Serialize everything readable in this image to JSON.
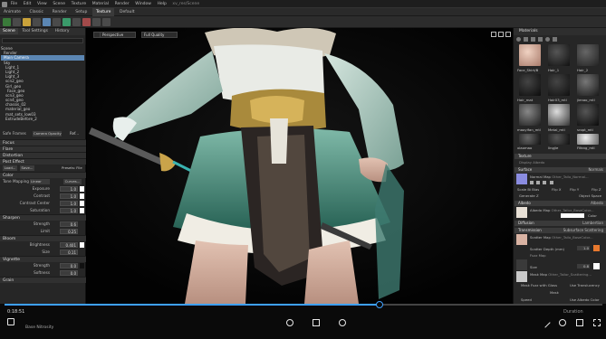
{
  "titlebar": {
    "items": [
      "File",
      "Edit",
      "View",
      "Scene",
      "Texture",
      "Material",
      "Render",
      "Window",
      "Help"
    ],
    "filename": "xv_res/Scene"
  },
  "tabbar": {
    "tabs": [
      "Animate",
      "Classic",
      "Render",
      "Setup",
      "Texture",
      "Default"
    ],
    "active": 4
  },
  "left_panel": {
    "tabs": [
      "Scene",
      "Tool Settings",
      "History"
    ],
    "active_tab": 0,
    "tree": [
      "Scene",
      "Render",
      "Main Camera",
      "Sky",
      "Light_1",
      "Light_2",
      "Light_3",
      "scn2_geo",
      "Girl_geo",
      "Face_geo",
      "scn3_geo",
      "scn4_geo",
      "chassis_02",
      "material_geo",
      "mat_sets_low03",
      "ExtrudeBefore_2"
    ],
    "selected_index": 2,
    "view_row": {
      "label": "Safe Frames",
      "value": "Camera Opacity",
      "button": "Ref..."
    },
    "sections": {
      "focus": "Focus",
      "flare": "Flare",
      "distortion": "Distortion",
      "post_effect": "Post Effect"
    },
    "post_buttons": [
      "Load...",
      "Save...",
      "Presets: File"
    ],
    "color_section": "Color",
    "tone_mapping": {
      "label": "Tone Mapping",
      "value": "Linear",
      "curves": "Curves..."
    },
    "color_rows": [
      {
        "label": "Exposure",
        "value": "1.0"
      },
      {
        "label": "Contrast",
        "value": "1.0"
      },
      {
        "label": "Contrast Center",
        "value": "1.0"
      },
      {
        "label": "Saturation",
        "value": "1.0"
      }
    ],
    "sharpen_section": "Sharpen",
    "sharpen_rows": [
      {
        "label": "Strength",
        "value": "0.6"
      },
      {
        "label": "Limit",
        "value": "0.25"
      }
    ],
    "bloom_section": "Bloom",
    "bloom_rows": [
      {
        "label": "Brightness",
        "value": "0.401"
      },
      {
        "label": "Size",
        "value": "0.11"
      }
    ],
    "vignette_section": "Vignette",
    "vignette_rows": [
      {
        "label": "Strength",
        "value": "0.0"
      },
      {
        "label": "Softness",
        "value": "0.0"
      }
    ],
    "grain_section": "Grain"
  },
  "viewport": {
    "camera": "Perspective",
    "quality": "Full Quality"
  },
  "right_panel": {
    "header": "Materials",
    "materials": [
      {
        "label": "Face_Shirt/B",
        "color": "#d8b7a7"
      },
      {
        "label": "Hair_1",
        "color": "#2a2a2a"
      },
      {
        "label": "Hair_2",
        "color": "#3a3a3a"
      },
      {
        "label": "Hair_mat",
        "color": "#1a1a1a"
      },
      {
        "label": "Hair03_mtl",
        "color": "#1d1d1d"
      },
      {
        "label": "jienao_mtl",
        "color": "#282828"
      },
      {
        "label": "maoyifan_mtl",
        "color": "#424242"
      },
      {
        "label": "Metal_mtl",
        "color": "#8a8a8a"
      },
      {
        "label": "sropt_mtl",
        "color": "#111111"
      },
      {
        "label": "xiaomao",
        "color": "#2e2e2e"
      },
      {
        "label": "lingjie",
        "color": "#141414"
      },
      {
        "label": "Fifang_mtl",
        "color": "#c0c0c0"
      }
    ],
    "texture_section": "Texture",
    "display_label": "Display Albedo",
    "surface_section": "Surface",
    "surface_value": "Normals",
    "normal_map": {
      "label": "Normal Map",
      "file": "Other_Tailo_Normal..."
    },
    "normal_opts": [
      "Scale Bi Bias",
      "Flip X",
      "Flip Y",
      "Flip Z"
    ],
    "normal_extra": [
      "Generate Z",
      "Object Space"
    ],
    "albedo_section": "Albedo",
    "albedo_value": "Albedo",
    "albedo_map": {
      "label": "Albedo Map",
      "file": "Other_Tailor_BaseColor..."
    },
    "albedo_color": "Color",
    "diffusion_section": "Diffusion",
    "diffusion_value": "Lambertian",
    "transmission_section": "Transmission",
    "transmission_value": "Subsurface Scattering",
    "scatter_map": {
      "label": "Scatter Map",
      "file": "Other_Tailo_BaseColor..."
    },
    "scatter_depth": {
      "label": "Scatter Depth (mm)",
      "value": "1.0"
    },
    "fuzz_map": "Fuzz Map",
    "fuzz_value": "0.8",
    "size_label": "Size",
    "mask_label": "Mask Map",
    "mask_file": "Other_Tailor_Scattering...",
    "mask_opt1": "Mask Fuzz with Gloss",
    "mask_opt2": "Use Translucency",
    "bottom_labels": [
      "Mask",
      "Speed",
      "Base Nitrosity"
    ],
    "bottom_value": "Use Albedo Color"
  },
  "playback": {
    "time": "0:18:51",
    "progress": 0.627,
    "duration": "Duration",
    "accent": "#3ea0ff"
  }
}
